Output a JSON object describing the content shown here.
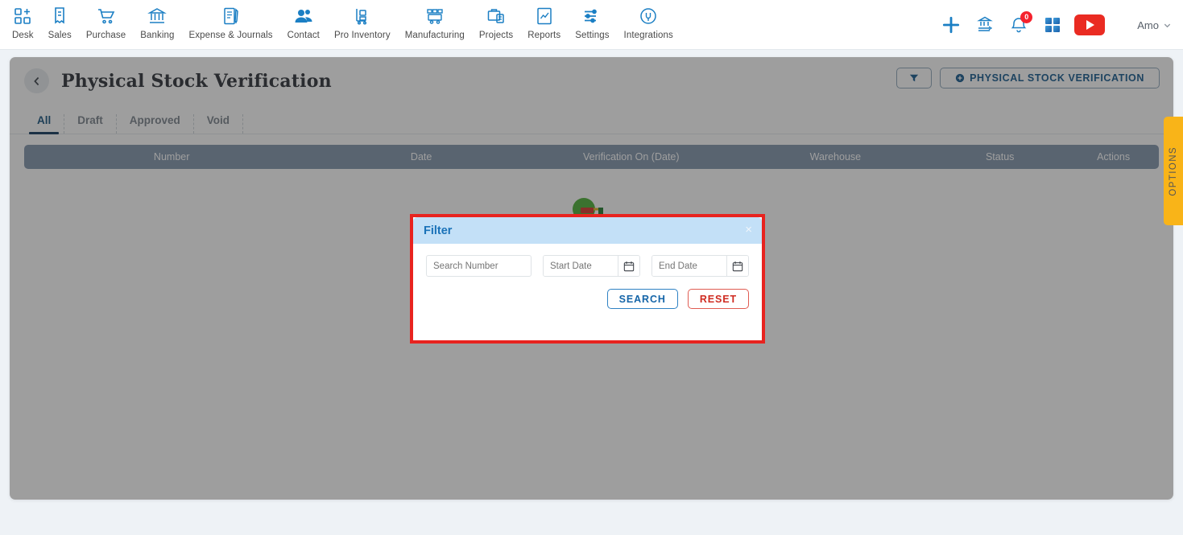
{
  "topnav": {
    "items": [
      {
        "label": "Desk",
        "icon": "desk-grid-plus-icon"
      },
      {
        "label": "Sales",
        "icon": "sales-receipt-icon"
      },
      {
        "label": "Purchase",
        "icon": "purchase-cart-icon"
      },
      {
        "label": "Banking",
        "icon": "banking-bank-icon"
      },
      {
        "label": "Expense & Journals",
        "icon": "expense-journal-icon"
      },
      {
        "label": "Contact",
        "icon": "contact-people-icon"
      },
      {
        "label": "Pro Inventory",
        "icon": "pro-inventory-trolley-icon"
      },
      {
        "label": "Manufacturing",
        "icon": "manufacturing-factory-icon"
      },
      {
        "label": "Projects",
        "icon": "projects-briefcase-icon"
      },
      {
        "label": "Reports",
        "icon": "reports-chart-icon"
      },
      {
        "label": "Settings",
        "icon": "settings-sliders-icon"
      },
      {
        "label": "Integrations",
        "icon": "integrations-plug-icon"
      }
    ],
    "right": {
      "add_icon": "plus-icon",
      "transfer_icon": "bank-transfer-icon",
      "notifications_icon": "bell-icon",
      "notifications_count": "0",
      "apps_icon": "grid-apps-icon",
      "video_icon": "youtube-play-icon",
      "user_name": "Amo",
      "user_chevron_icon": "chevron-down-icon"
    }
  },
  "page": {
    "back_icon": "chevron-left-icon",
    "title": "Physical Stock Verification",
    "filter_button_icon": "funnel-icon",
    "create_button_label": "PHYSICAL STOCK VERIFICATION",
    "create_button_icon": "plus-circle-icon",
    "options_tab_label": "OPTIONS"
  },
  "tabs": [
    {
      "label": "All",
      "active": true
    },
    {
      "label": "Draft",
      "active": false
    },
    {
      "label": "Approved",
      "active": false
    },
    {
      "label": "Void",
      "active": false
    }
  ],
  "table": {
    "columns": [
      "Number",
      "Date",
      "Verification On (Date)",
      "Warehouse",
      "Status",
      "Actions"
    ],
    "rows": []
  },
  "modal": {
    "title": "Filter",
    "close_icon": "close-icon",
    "search_number": {
      "value": "",
      "placeholder": "Search Number"
    },
    "start_date": {
      "value": "",
      "placeholder": "Start Date",
      "icon": "calendar-icon"
    },
    "end_date": {
      "value": "",
      "placeholder": "End Date",
      "icon": "calendar-icon"
    },
    "search_label": "SEARCH",
    "reset_label": "RESET"
  },
  "colors": {
    "nav_icon": "#1b7fc4",
    "accent_blue": "#1565a8",
    "danger_red": "#cf2b20",
    "header_row": "#8195ab",
    "modal_header": "#c3e0f7",
    "options_yellow": "#f9b418",
    "highlight_border": "#e8231f"
  }
}
